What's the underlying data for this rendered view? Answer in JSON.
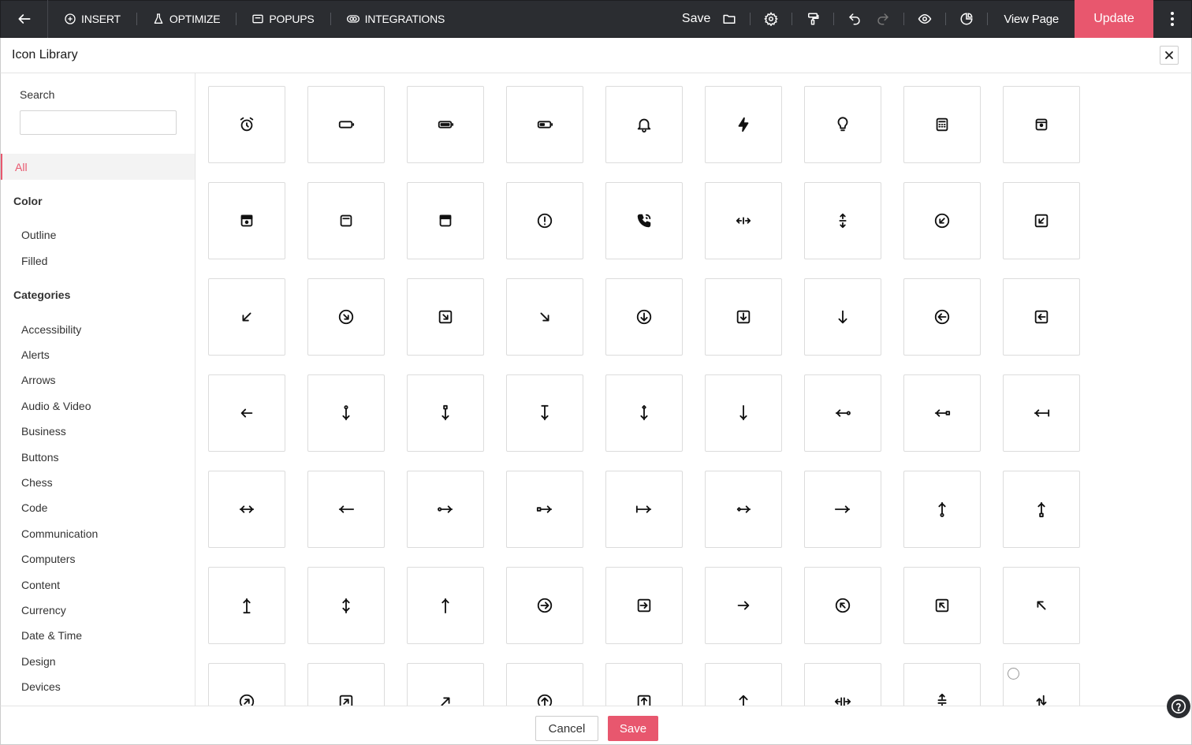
{
  "topbar": {
    "menu": [
      {
        "label": "INSERT",
        "icon": "plus-circle-icon"
      },
      {
        "label": "OPTIMIZE",
        "icon": "flask-icon"
      },
      {
        "label": "POPUPS",
        "icon": "popup-window-icon"
      },
      {
        "label": "INTEGRATIONS",
        "icon": "link-rings-icon"
      }
    ],
    "save_label": "Save",
    "view_label": "View Page",
    "update_label": "Update",
    "accent": "#e8576e",
    "background": "#2b2d31"
  },
  "modal": {
    "title": "Icon Library"
  },
  "sidebar": {
    "search_label": "Search",
    "search_value": "",
    "all_label": "All",
    "color_title": "Color",
    "color_items": [
      "Outline",
      "Filled"
    ],
    "categories_title": "Categories",
    "category_items": [
      "Accessibility",
      "Alerts",
      "Arrows",
      "Audio & Video",
      "Business",
      "Buttons",
      "Chess",
      "Code",
      "Communication",
      "Computers",
      "Content",
      "Currency",
      "Date & Time",
      "Design",
      "Devices"
    ]
  },
  "icons": [
    "alarm-clock-icon",
    "battery-empty-icon",
    "battery-full-icon",
    "battery-half-icon",
    "bell-icon",
    "lightning-bolt-icon",
    "lightbulb-icon",
    "calculator-icon",
    "app-window-dot-icon",
    "app-window-filled-icon",
    "app-window-icon",
    "app-window-top-icon",
    "alert-circle-icon",
    "phone-incoming-icon",
    "arrows-horizontal-collapse-icon",
    "arrows-vertical-collapse-icon",
    "arrow-down-left-circle-icon",
    "arrow-down-left-square-icon",
    "arrow-down-left-icon",
    "arrow-down-right-circle-icon",
    "arrow-down-right-square-icon",
    "arrow-down-right-icon",
    "arrow-down-circle-icon",
    "arrow-down-square-icon",
    "arrow-down-icon",
    "arrow-left-circle-icon",
    "arrow-left-square-icon",
    "arrow-left-icon",
    "arrow-vertical-circle-end-icon",
    "arrow-vertical-square-end-icon",
    "arrow-vertical-bar-icon",
    "arrow-vertical-diamond-icon",
    "arrow-down-bar-icon",
    "arrow-horizontal-circle-icon",
    "arrow-horizontal-square-icon",
    "arrow-left-bar-icon",
    "arrow-horizontal-diamond-icon",
    "arrow-left-long-icon",
    "arrow-right-circle-start-icon",
    "arrow-right-square-start-icon",
    "arrow-right-bar-icon",
    "arrow-right-diamond-icon",
    "arrow-right-long-icon",
    "arrow-up-circle-start-icon",
    "arrow-up-square-start-icon",
    "arrow-up-bar-icon",
    "arrow-up-diamond-icon",
    "arrow-up-long-icon",
    "arrow-right-circle-icon",
    "arrow-right-square-icon",
    "arrow-right-icon",
    "arrow-up-left-circle-icon",
    "arrow-up-left-square-icon",
    "arrow-up-left-icon",
    "arrow-up-right-circle-icon",
    "arrow-up-right-square-icon",
    "arrow-up-right-icon",
    "arrow-up-circle-icon",
    "arrow-up-square-icon",
    "arrow-up-icon",
    "arrows-horizontal-expand-icon",
    "arrows-vertical-expand-icon",
    "arrows-sort-icon"
  ],
  "footer": {
    "cancel_label": "Cancel",
    "save_label": "Save"
  }
}
